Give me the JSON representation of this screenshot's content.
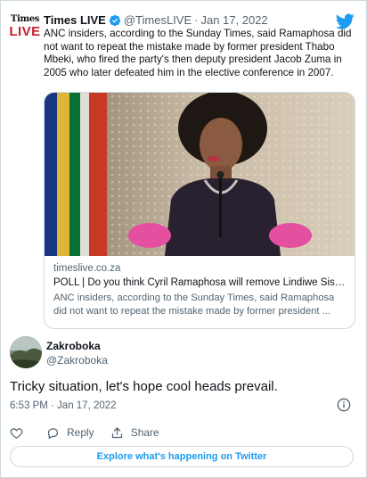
{
  "quoted": {
    "logo_line1": "Times",
    "logo_line2": "LIVE",
    "name": "Times LIVE",
    "handle": "@TimesLIVE",
    "separator": "·",
    "date": "Jan 17, 2022",
    "text": "ANC insiders, according to the Sunday Times, said Ramaphosa did not want to repeat the mistake made by former president Thabo Mbeki, who fired the party's then deputy president Jacob Zuma in 2005 who later defeated him in the elective conference in 2007.",
    "link_card": {
      "domain": "timeslive.co.za",
      "title": "POLL | Do you think Cyril Ramaphosa will remove Lindiwe Sisulu...",
      "description": "ANC insiders, according to the Sunday Times, said Ramaphosa did not want to repeat the mistake made by former president ..."
    }
  },
  "tweet": {
    "author_name": "Zakroboka",
    "author_handle": "@Zakroboka",
    "text": "Tricky situation, let's hope cool heads prevail.",
    "timestamp": "6:53 PM · Jan 17, 2022"
  },
  "actions": {
    "like_icon": "heart-icon",
    "reply_label": "Reply",
    "share_label": "Share"
  },
  "explore_label": "Explore what's happening on Twitter",
  "colors": {
    "twitter_blue": "#1d9bf0",
    "secondary_text": "#536471",
    "border": "#cfd9de",
    "logo_red": "#c8202a"
  }
}
